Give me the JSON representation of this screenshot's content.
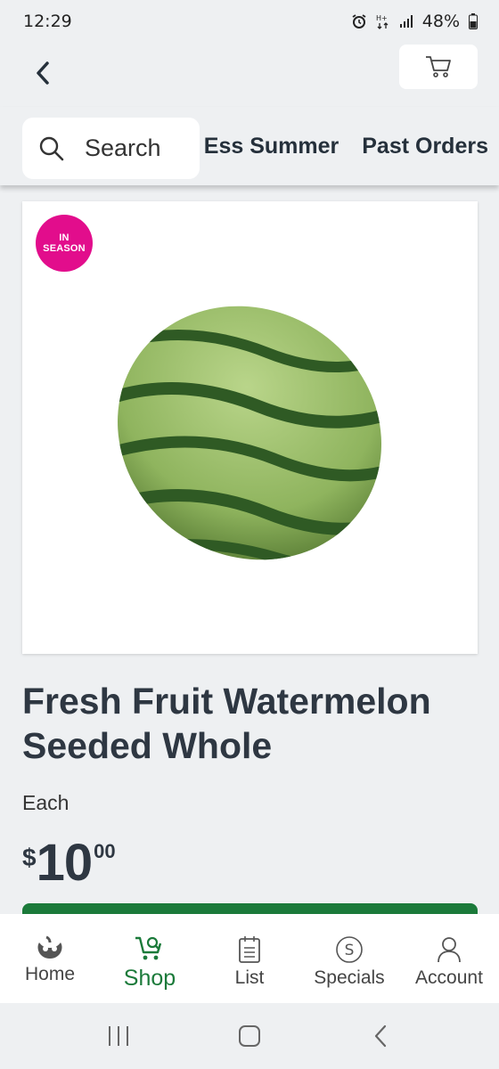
{
  "status": {
    "time": "12:29",
    "battery": "48%"
  },
  "nav_links": [
    "Ess Summer",
    "Past Orders"
  ],
  "search": {
    "label": "Search"
  },
  "product": {
    "badge_line1": "IN",
    "badge_line2": "SEASON",
    "title": "Fresh Fruit Watermelon Seeded Whole",
    "unit": "Each",
    "price_currency": "$",
    "price_dollars": "10",
    "price_cents": "00"
  },
  "bottom_nav": [
    {
      "label": "Home",
      "icon": "woolworths-logo-icon"
    },
    {
      "label": "Shop",
      "icon": "cart-search-icon",
      "active": true
    },
    {
      "label": "List",
      "icon": "list-icon"
    },
    {
      "label": "Specials",
      "icon": "dollar-circle-icon"
    },
    {
      "label": "Account",
      "icon": "user-icon"
    }
  ],
  "colors": {
    "accent_green": "#1b7a3a",
    "badge_pink": "#e20d8c",
    "text_dark": "#2e3742"
  }
}
